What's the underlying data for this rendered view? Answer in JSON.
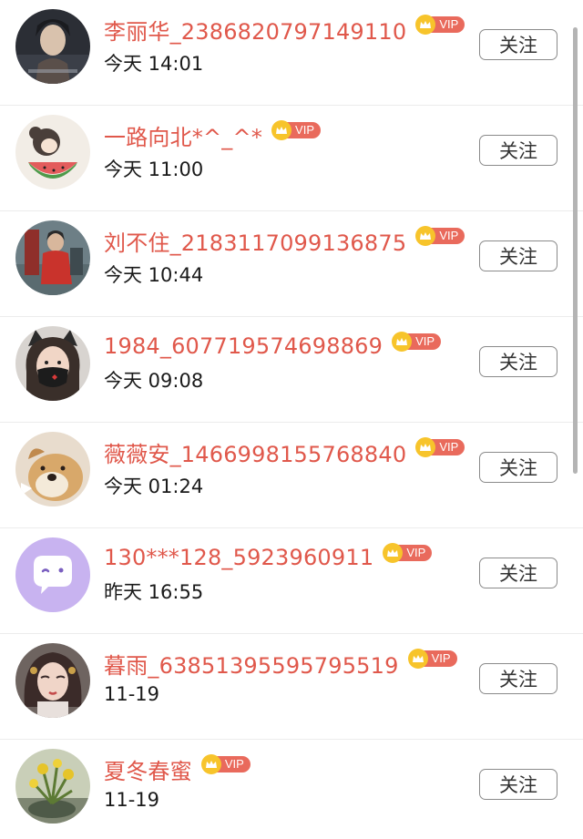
{
  "follow_label": "关注",
  "vip_label": "VIP",
  "colors": {
    "username": "#e0584b",
    "vip_badge": "#e96a5c",
    "crown": "#f7c42b"
  },
  "users": [
    {
      "name": "李丽华_2386820797149110",
      "time": "今天 14:01",
      "avatar": "photo-dark-portrait"
    },
    {
      "name": "一路向北*^_^*",
      "time": "今天 11:00",
      "avatar": "cartoon-girl-watermelon"
    },
    {
      "name": "刘不住_2183117099136875",
      "time": "今天 10:44",
      "avatar": "photo-red-outdoor"
    },
    {
      "name": "1984_607719574698869",
      "time": "今天 09:08",
      "avatar": "girl-cat-ears-mask"
    },
    {
      "name": "薇薇安_1466998155768840",
      "time": "今天 01:24",
      "avatar": "puppy-photo"
    },
    {
      "name": "130***128_5923960911",
      "time": "昨天 16:55",
      "avatar": "default-chat-bubble"
    },
    {
      "name": "暮雨_63851395595795519",
      "time": "11-19",
      "avatar": "illustrated-woman"
    },
    {
      "name": "夏冬春蜜",
      "time": "11-19",
      "avatar": "plant-photo"
    }
  ]
}
